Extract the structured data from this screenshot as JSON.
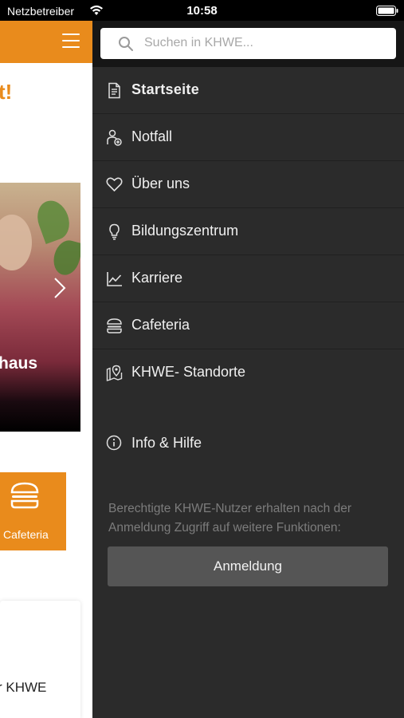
{
  "status_bar": {
    "carrier": "Netzbetreiber",
    "time": "10:58"
  },
  "background_app": {
    "headline_fragment": "t!",
    "photo_caption_fragment": "haus",
    "tile_label": "Cafeteria",
    "card_text_fragment": "r KHWE"
  },
  "drawer": {
    "search_placeholder": "Suchen in KHWE...",
    "items": [
      {
        "label": "Startseite",
        "icon": "document-icon",
        "active": true
      },
      {
        "label": "Notfall",
        "icon": "emergency-icon"
      },
      {
        "label": "Über uns",
        "icon": "heart-icon"
      },
      {
        "label": "Bildungszentrum",
        "icon": "lightbulb-icon"
      },
      {
        "label": "Karriere",
        "icon": "chart-line-icon"
      },
      {
        "label": "Cafeteria",
        "icon": "burger-icon"
      },
      {
        "label": "KHWE- Standorte",
        "icon": "map-pin-icon"
      }
    ],
    "info_item": {
      "label": "Info & Hilfe",
      "icon": "info-icon"
    },
    "note": "Berechtigte KHWE-Nutzer erhalten nach der Anmeldung Zugriff auf weitere Funktionen:",
    "login_button": "Anmeldung"
  },
  "colors": {
    "accent": "#e98b1c",
    "drawer_bg": "#2b2b2b",
    "search_bar_bg": "#161616",
    "button_bg": "#555555"
  }
}
